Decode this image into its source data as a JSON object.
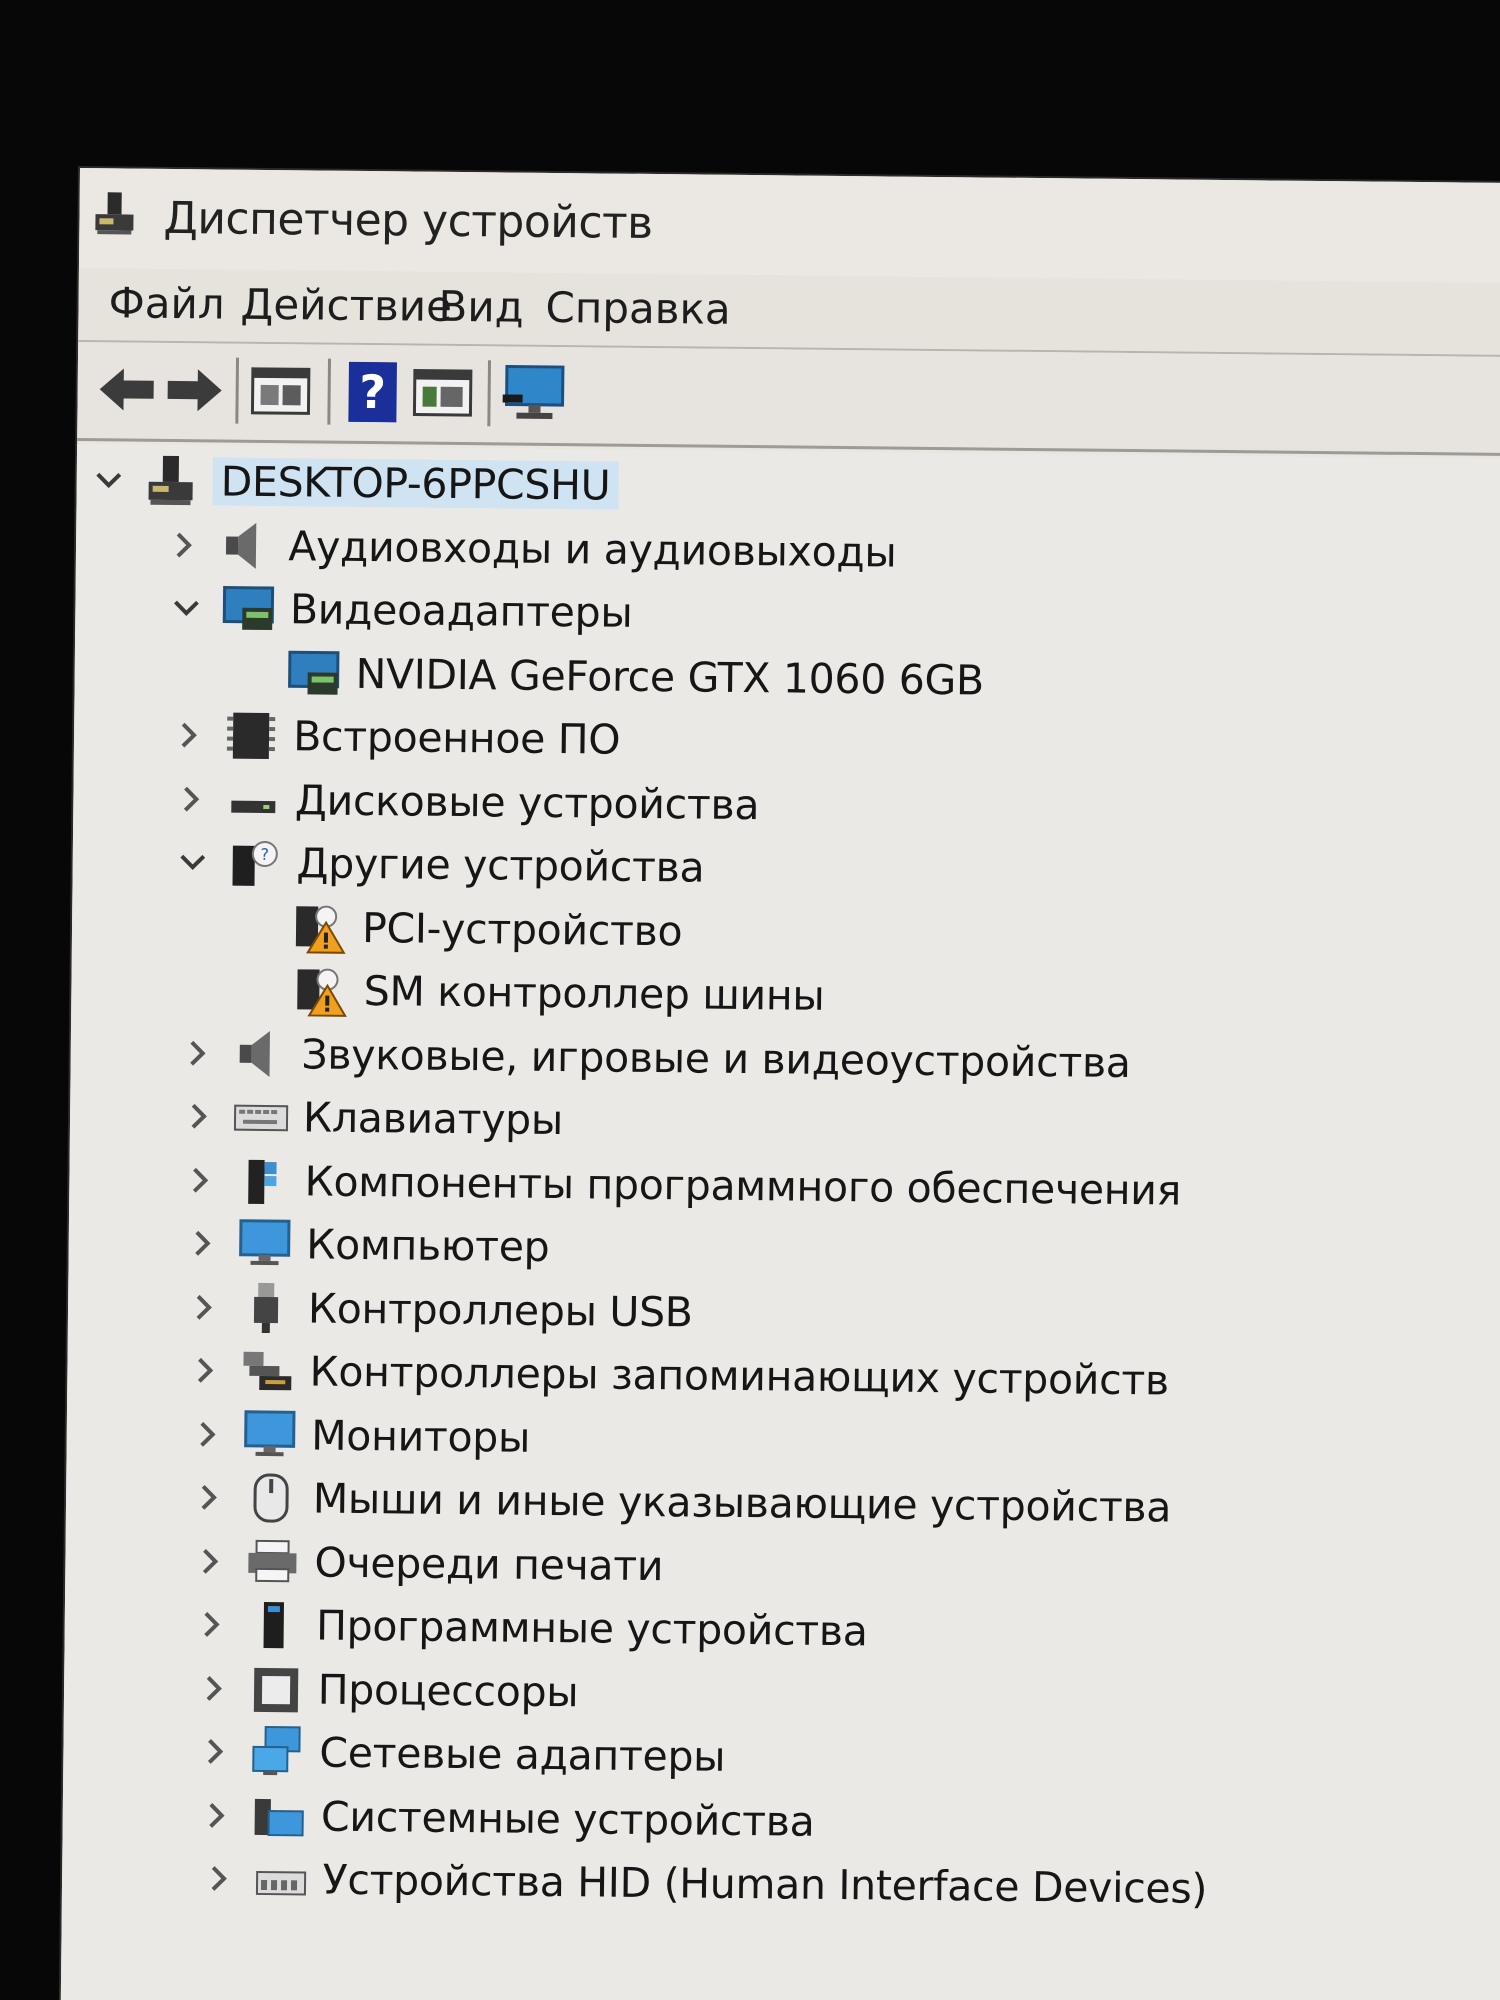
{
  "window": {
    "title": "Диспетчер устройств"
  },
  "menu": [
    "Файл",
    "Действие",
    "Вид",
    "Справка"
  ],
  "toolbar": {
    "buttons": [
      {
        "name": "back-arrow-icon"
      },
      {
        "name": "forward-arrow-icon"
      },
      {
        "name": "properties-window-icon"
      },
      {
        "name": "help-icon"
      },
      {
        "name": "update-driver-window-icon"
      },
      {
        "name": "scan-hardware-monitor-icon"
      }
    ]
  },
  "tree": {
    "root": {
      "label": "DESKTOP-6PPCSHU",
      "expanded": true,
      "icon": "computer-tower-icon"
    },
    "categories": [
      {
        "label": "Аудиовходы и аудиовыходы",
        "expanded": false,
        "icon": "speaker-icon"
      },
      {
        "label": "Видеоадаптеры",
        "expanded": true,
        "icon": "display-adapter-icon",
        "children": [
          {
            "label": "NVIDIA GeForce GTX 1060 6GB",
            "icon": "display-adapter-icon"
          }
        ]
      },
      {
        "label": "Встроенное ПО",
        "expanded": false,
        "icon": "firmware-chip-icon"
      },
      {
        "label": "Дисковые устройства",
        "expanded": false,
        "icon": "disk-drive-icon"
      },
      {
        "label": "Другие устройства",
        "expanded": true,
        "icon": "unknown-device-icon",
        "children": [
          {
            "label": "PCI-устройство",
            "icon": "warning-device-icon"
          },
          {
            "label": "SM контроллер шины",
            "icon": "warning-device-icon"
          }
        ]
      },
      {
        "label": "Звуковые, игровые и видеоустройства",
        "expanded": false,
        "icon": "speaker-icon"
      },
      {
        "label": "Клавиатуры",
        "expanded": false,
        "icon": "keyboard-icon"
      },
      {
        "label": "Компоненты программного обеспечения",
        "expanded": false,
        "icon": "software-component-icon"
      },
      {
        "label": "Компьютер",
        "expanded": false,
        "icon": "monitor-icon"
      },
      {
        "label": "Контроллеры USB",
        "expanded": false,
        "icon": "usb-plug-icon"
      },
      {
        "label": "Контроллеры запоминающих устройств",
        "expanded": false,
        "icon": "storage-controller-icon"
      },
      {
        "label": "Мониторы",
        "expanded": false,
        "icon": "monitor-icon"
      },
      {
        "label": "Мыши и иные указывающие устройства",
        "expanded": false,
        "icon": "mouse-icon"
      },
      {
        "label": "Очереди печати",
        "expanded": false,
        "icon": "printer-icon"
      },
      {
        "label": "Программные устройства",
        "expanded": false,
        "icon": "software-device-icon"
      },
      {
        "label": "Процессоры",
        "expanded": false,
        "icon": "processor-icon"
      },
      {
        "label": "Сетевые адаптеры",
        "expanded": false,
        "icon": "network-adapter-icon"
      },
      {
        "label": "Системные устройства",
        "expanded": false,
        "icon": "system-device-icon"
      },
      {
        "label": "Устройства HID (Human Interface Devices)",
        "expanded": false,
        "icon": "hid-device-icon"
      }
    ]
  },
  "colors": {
    "selection": "#cfe3f2",
    "window_bg": "#ebe9e6",
    "warning": "#f0a020",
    "help_blue": "#1b2f9a"
  }
}
